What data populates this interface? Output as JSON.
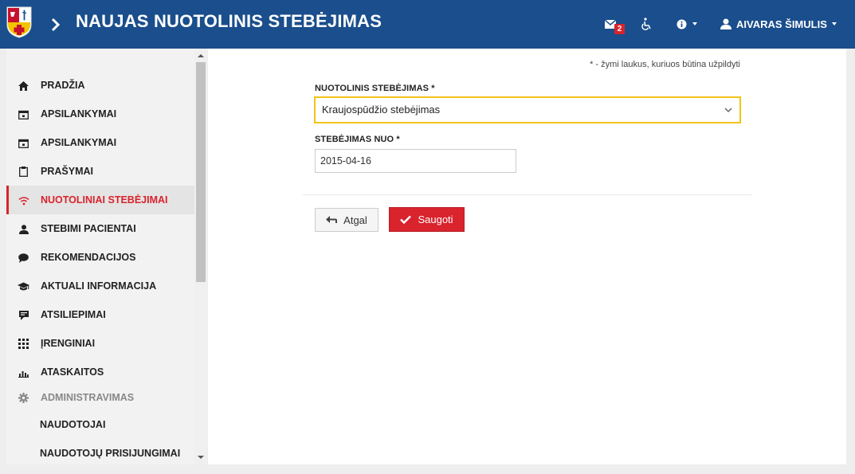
{
  "header": {
    "title": "NAUJAS NUOTOLINIS STEBĖJIMAS",
    "mail_count": "2",
    "user_name": "AIVARAS ŠIMULIS",
    "bg_color": "#1a4e8c"
  },
  "sidebar": {
    "items": [
      {
        "label": "PRADŽIA",
        "icon": "home-icon"
      },
      {
        "label": "APSILANKYMAI",
        "icon": "calendar-icon"
      },
      {
        "label": "APSILANKYMAI",
        "icon": "calendar-icon"
      },
      {
        "label": "PRAŠYMAI",
        "icon": "clipboard-icon"
      },
      {
        "label": "NUOTOLINIAI STEBĖJIMAI",
        "icon": "wifi-icon",
        "active": true
      },
      {
        "label": "STEBIMI PACIENTAI",
        "icon": "user-icon"
      },
      {
        "label": "REKOMENDACIJOS",
        "icon": "comment-icon"
      },
      {
        "label": "AKTUALI INFORMACIJA",
        "icon": "graduation-cap-icon"
      },
      {
        "label": "ATSILIEPIMAI",
        "icon": "feedback-icon"
      },
      {
        "label": "ĮRENGINIAI",
        "icon": "grid-icon"
      },
      {
        "label": "ATASKAITOS",
        "icon": "bar-chart-icon"
      },
      {
        "label": "ADMINISTRAVIMAS",
        "icon": "gear-icon"
      },
      {
        "label": "NAUDOTOJAI"
      },
      {
        "label": "NAUDOTOJŲ PRISIJUNGIMAI"
      }
    ],
    "active_color": "#d9232d"
  },
  "form": {
    "required_note": "* - žymi laukus, kuriuos būtina užpildyti",
    "monitoring_label": "NUOTOLINIS STEBĖJIMAS *",
    "monitoring_value": "Kraujospūdžio stebėjimas",
    "start_label": "STEBĖJIMAS NUO *",
    "start_value": "2015-04-16",
    "focus_color": "#f0c419"
  },
  "actions": {
    "back_label": "Atgal",
    "save_label": "Saugoti",
    "save_color": "#d9232d"
  }
}
